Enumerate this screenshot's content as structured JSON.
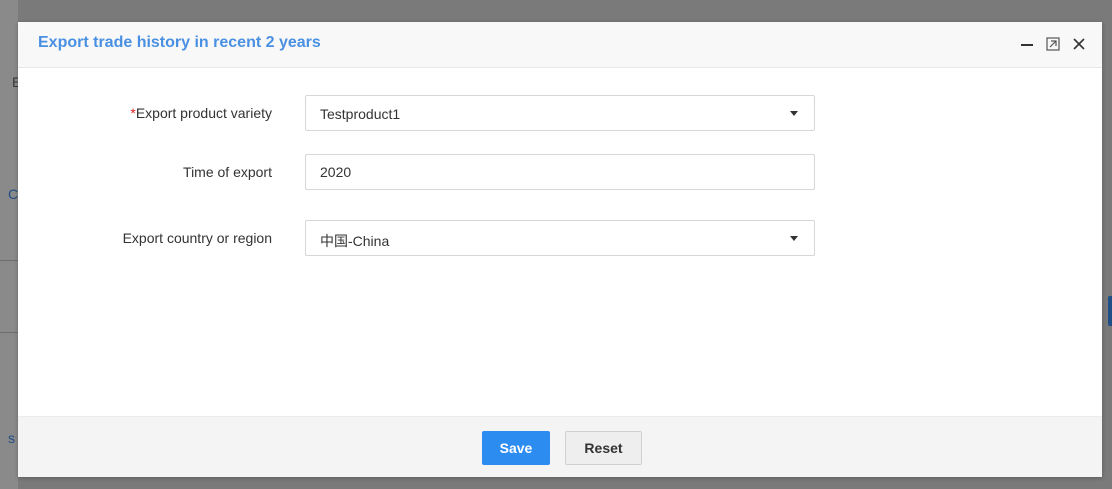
{
  "background": {
    "fragments": [
      "E",
      "C",
      "s"
    ]
  },
  "dialog": {
    "title": "Export trade history in recent 2 years",
    "controls": {
      "minimize_icon": "minimize-icon",
      "maximize_icon": "maximize-icon",
      "close_icon": "close-icon"
    }
  },
  "form": {
    "product_variety": {
      "required_mark": "*",
      "label": "Export product variety",
      "value": "Testproduct1"
    },
    "time_of_export": {
      "label": "Time of export",
      "value": "2020"
    },
    "country_region": {
      "label": "Export country or region",
      "value": "中国-China"
    }
  },
  "footer": {
    "save_label": "Save",
    "reset_label": "Reset"
  },
  "colors": {
    "title": "#4a90e2",
    "primary_button": "#2d8cf0",
    "required": "#e02020",
    "overlay": "#7a7a7a"
  }
}
